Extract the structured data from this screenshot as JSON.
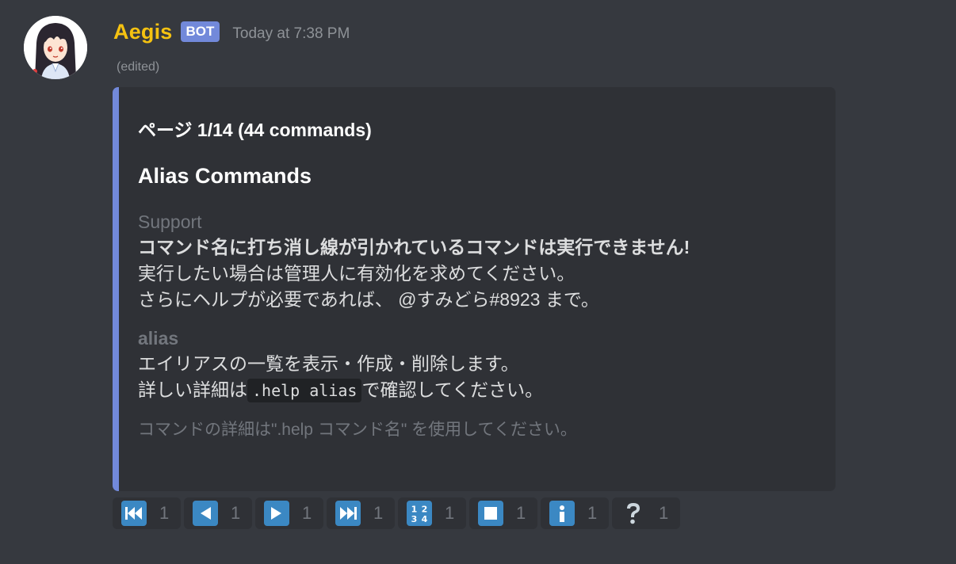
{
  "message": {
    "username": "Aegis",
    "bot_tag": "BOT",
    "timestamp": "Today at 7:38 PM",
    "edited": "(edited)"
  },
  "colors": {
    "username": "#f5c211",
    "bot_tag": "#7289da",
    "embed_bar": "#7289da",
    "reaction_emoji": "#3b88c3"
  },
  "embed": {
    "author": "ページ 1/14 (44 commands)",
    "title": "Alias Commands",
    "fields": [
      {
        "name": "Support",
        "value_bold": "コマンド名に打ち消し線が引かれているコマンドは実行できません!",
        "value_line2": "実行したい場合は管理人に有効化を求めてください。",
        "value_line3": "さらにヘルプが必要であれば、 @すみどら#8923 まで。"
      },
      {
        "name": "alias",
        "value_line1": "エイリアスの一覧を表示・作成・削除します。",
        "value_prefix": "詳しい詳細は",
        "value_code": ".help alias",
        "value_suffix": "で確認してください。"
      }
    ],
    "footer": "コマンドの詳細は\".help コマンド名\" を使用してください。"
  },
  "reactions": [
    {
      "icon": "first-page-icon",
      "count": "1"
    },
    {
      "icon": "previous-page-icon",
      "count": "1"
    },
    {
      "icon": "next-page-icon",
      "count": "1"
    },
    {
      "icon": "last-page-icon",
      "count": "1"
    },
    {
      "icon": "page-number-input-icon",
      "count": "1"
    },
    {
      "icon": "stop-icon",
      "count": "1"
    },
    {
      "icon": "info-icon",
      "count": "1"
    },
    {
      "icon": "help-question-icon",
      "count": "1"
    }
  ]
}
